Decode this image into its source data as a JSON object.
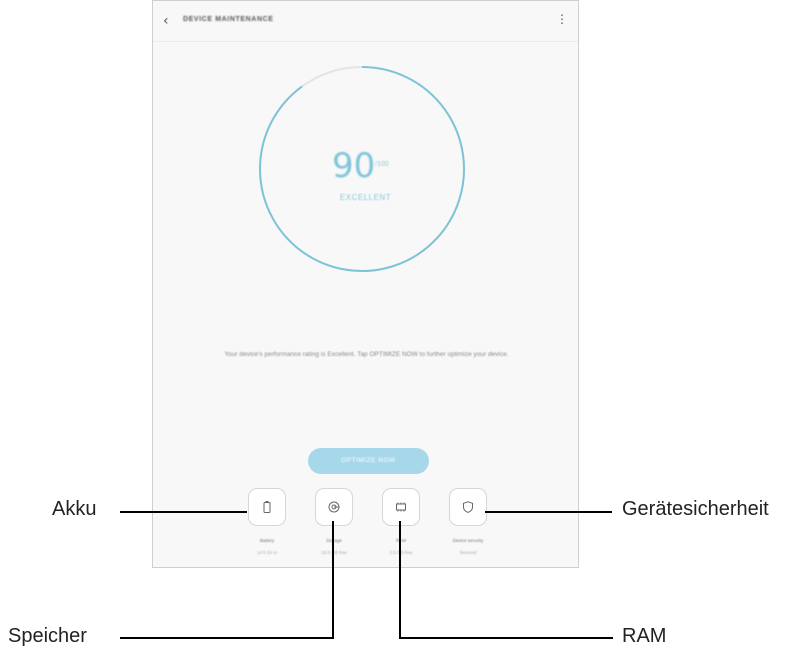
{
  "app": {
    "title": "DEVICE MAINTENANCE",
    "back_icon": "back-arrow-icon",
    "more_icon": "more-vert-icon"
  },
  "gauge": {
    "score": "90",
    "unit": "/100",
    "status": "EXCELLENT",
    "level": 0.9,
    "accent": "#7ec4d8"
  },
  "message": "Your device's performance rating is Excellent. Tap OPTIMIZE NOW to further optimize your device.",
  "optimize_button": "OPTIMIZE NOW",
  "categories": [
    {
      "id": "battery",
      "icon": "battery-icon",
      "label": "Battery",
      "value": "14 h 24 m"
    },
    {
      "id": "storage",
      "icon": "storage-icon",
      "label": "Storage",
      "value": "15.5 GB free"
    },
    {
      "id": "ram",
      "icon": "ram-chip-icon",
      "label": "RAM",
      "value": "2.5 GB free"
    },
    {
      "id": "security",
      "icon": "shield-icon",
      "label": "Device security",
      "value": "Secured"
    }
  ],
  "callouts": {
    "akku": "Akku",
    "speicher": "Speicher",
    "ram": "RAM",
    "sicherheit": "Gerätesicherheit"
  }
}
